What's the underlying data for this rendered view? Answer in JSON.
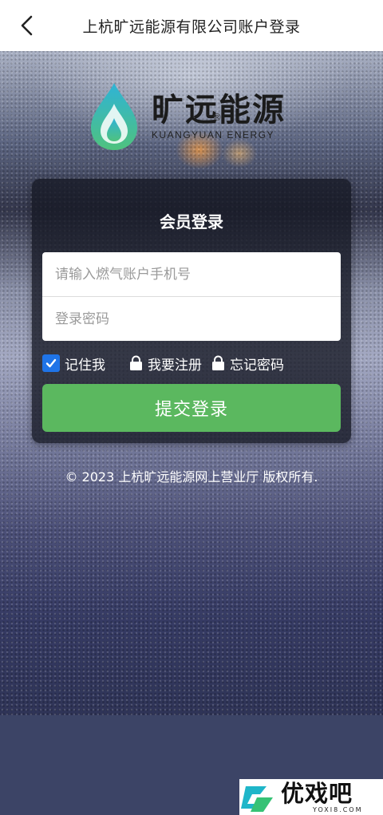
{
  "header": {
    "title": "上杭旷远能源有限公司账户登录",
    "back_icon": "chevron-left-icon"
  },
  "logo": {
    "cn": "旷远能源",
    "en": "KUANGYUAN ENERGY",
    "registered": "®"
  },
  "login": {
    "title": "会员登录",
    "phone_placeholder": "请输入燃气账户手机号",
    "password_placeholder": "登录密码",
    "remember_label": "记住我",
    "remember_checked": true,
    "register_label": "我要注册",
    "forgot_label": "忘记密码",
    "submit_label": "提交登录"
  },
  "footer": {
    "copyright": "© 2023 上杭旷远能源网上营业厅 版权所有."
  },
  "watermark": {
    "cn": "优戏吧",
    "en": "YOXI8.COM"
  },
  "colors": {
    "primary_button": "#5bb85f",
    "checkbox": "#1f74e8",
    "card_bg": "#16182490"
  }
}
